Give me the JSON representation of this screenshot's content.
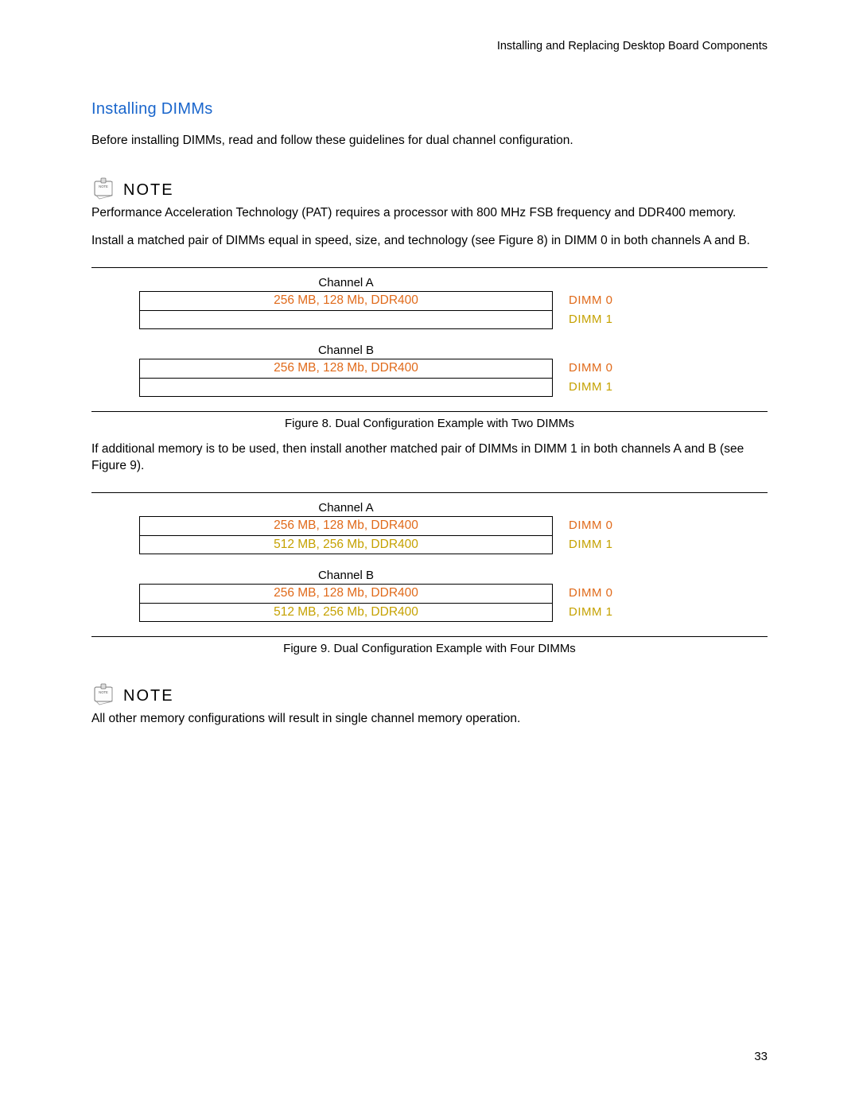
{
  "header": {
    "running_title": "Installing and Replacing Desktop Board Components"
  },
  "section": {
    "heading": "Installing DIMMs",
    "intro": "Before installing DIMMs, read and follow these guidelines for dual channel configuration."
  },
  "note1": {
    "label": "NOTE",
    "text": "Performance Acceleration Technology (PAT) requires a processor with 800 MHz FSB frequency and DDR400 memory."
  },
  "para1": "Install a matched pair of DIMMs equal in speed, size, and technology (see Figure 8) in DIMM 0 in both channels A and B.",
  "figure8": {
    "caption": "Figure 8.  Dual Configuration Example with Two DIMMs",
    "channels": [
      {
        "label": "Channel A",
        "slots": [
          {
            "content": "256 MB, 128 Mb, DDR400",
            "content_color": "orange",
            "slot_label": "DIMM 0",
            "slot_color": "orange"
          },
          {
            "content": "",
            "content_color": "",
            "slot_label": "DIMM 1",
            "slot_color": "olive"
          }
        ]
      },
      {
        "label": "Channel B",
        "slots": [
          {
            "content": "256 MB, 128 Mb, DDR400",
            "content_color": "orange",
            "slot_label": "DIMM 0",
            "slot_color": "orange"
          },
          {
            "content": "",
            "content_color": "",
            "slot_label": "DIMM 1",
            "slot_color": "olive"
          }
        ]
      }
    ]
  },
  "para2": "If additional memory is to be used, then install another matched pair of DIMMs in DIMM 1 in both channels A and B (see Figure 9).",
  "figure9": {
    "caption": "Figure 9.  Dual Configuration Example with Four DIMMs",
    "channels": [
      {
        "label": "Channel A",
        "slots": [
          {
            "content": "256 MB, 128 Mb, DDR400",
            "content_color": "orange",
            "slot_label": "DIMM 0",
            "slot_color": "orange"
          },
          {
            "content": "512 MB, 256 Mb, DDR400",
            "content_color": "olive",
            "slot_label": "DIMM 1",
            "slot_color": "olive"
          }
        ]
      },
      {
        "label": "Channel B",
        "slots": [
          {
            "content": "256 MB, 128 Mb, DDR400",
            "content_color": "orange",
            "slot_label": "DIMM 0",
            "slot_color": "orange"
          },
          {
            "content": "512 MB, 256 Mb, DDR400",
            "content_color": "olive",
            "slot_label": "DIMM 1",
            "slot_color": "olive"
          }
        ]
      }
    ]
  },
  "note2": {
    "label": "NOTE",
    "text": "All other memory configurations will result in single channel memory operation."
  },
  "page_number": "33"
}
